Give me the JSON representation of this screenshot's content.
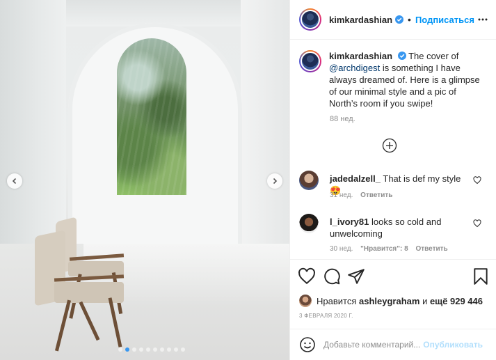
{
  "post": {
    "photo": {
      "dots_count": 10,
      "active_dot": 1
    },
    "header": {
      "username": "kimkardashian",
      "separator": "•",
      "follow_label": "Подписаться"
    },
    "caption": {
      "username": "kimkardashian",
      "text_before_mention": "The cover of",
      "mention": "@archdigest",
      "text_after_mention": "is something I have always dreamed of. Here is a glimpse of our minimal style and a pic of North’s room if you swipe!",
      "age": "88 нед."
    },
    "comments": [
      {
        "username": "jadedalzell_",
        "text": "That is def my style 😍",
        "age": "31 нед.",
        "reply_label": "Ответить"
      },
      {
        "username": "l_ivory81",
        "text": "looks so cold and unwelcoming",
        "age": "30 нед.",
        "likes_label": "\"Нравится\": 8",
        "reply_label": "Ответить"
      }
    ],
    "likes": {
      "prefix": "Нравится",
      "user": "ashleygraham",
      "connector": "и",
      "rest": "ещё 929 446"
    },
    "date": "3 ФЕВРАЛЯ 2020 Г.",
    "add_comment": {
      "placeholder": "Добавьте комментарий...",
      "post_label": "Опубликовать"
    },
    "colors": {
      "accent": "#0095f6",
      "link": "#00376b",
      "muted": "#8e8e8e",
      "active_dot": "#3897f0"
    },
    "icons": [
      "chevron-left-icon",
      "chevron-right-icon",
      "verified-badge-icon",
      "more-icon",
      "plus-circle-icon",
      "heart-icon",
      "comment-icon",
      "share-icon",
      "bookmark-icon",
      "emoji-icon"
    ]
  }
}
